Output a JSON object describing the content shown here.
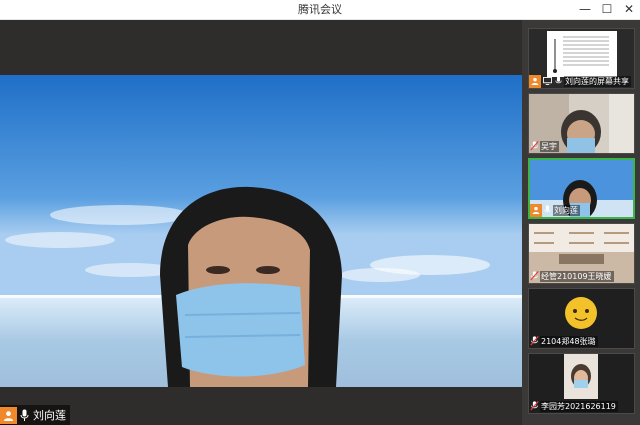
{
  "window": {
    "title": "腾讯会议",
    "controls": {
      "minimize": "—",
      "maximize": "☐",
      "close": "✕"
    }
  },
  "main_speaker": {
    "name": "刘向莲",
    "role_icon": "host-icon",
    "mic": "mic-on"
  },
  "participants": [
    {
      "name": "刘向莲的屏幕共享",
      "kind": "screen-share",
      "host": true,
      "active": false
    },
    {
      "name": "吴宇",
      "kind": "video",
      "host": false,
      "mic": "mic-muted",
      "active": false
    },
    {
      "name": "刘向莲",
      "kind": "video",
      "host": true,
      "mic": "mic-on",
      "active": true
    },
    {
      "name": "经管210109王晓媛",
      "kind": "video",
      "host": false,
      "mic": "mic-muted",
      "active": false
    },
    {
      "name": "2104郑48张璐",
      "kind": "avatar",
      "host": false,
      "mic": "mic-muted",
      "active": false
    },
    {
      "name": "李园芳2021626119",
      "kind": "video",
      "host": false,
      "mic": "mic-muted",
      "active": false
    }
  ],
  "colors": {
    "host_badge": "#f0892c",
    "active_border": "#39b54a",
    "muted": "#e04040"
  }
}
